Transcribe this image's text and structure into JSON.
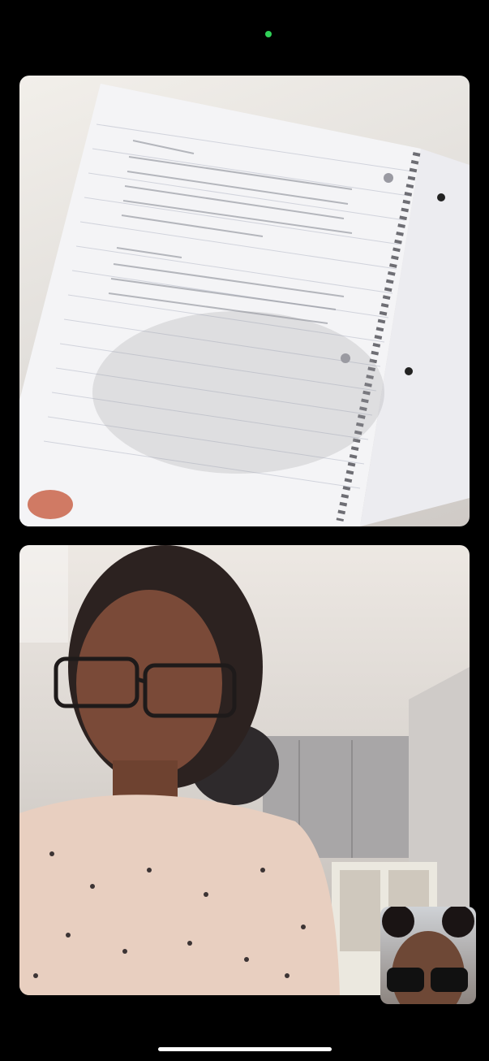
{
  "call": {
    "camera_indicator_color": "#30d158",
    "camera_indicator_icon": "camera-active-dot"
  },
  "remote_top": {
    "content": "notebook-page-held-to-camera"
  },
  "remote_bottom": {
    "content": "participant-video"
  },
  "self_view": {
    "content": "self-camera-preview"
  },
  "system": {
    "home_indicator_icon": "home-indicator-bar"
  }
}
